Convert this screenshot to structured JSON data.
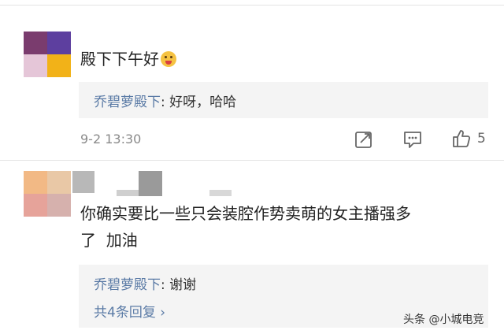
{
  "comments": [
    {
      "text": "殿下下午好",
      "emoji": "smiling-face-emoji",
      "reply": {
        "name": "乔碧萝殿下",
        "text": ": 好呀，哈哈"
      },
      "time": "9-2 13:30",
      "like_count": "5"
    },
    {
      "text_line1": "你确实要比一些只会装腔作势卖萌的女主播强多",
      "text_line2": "了  加油",
      "reply": {
        "name": "乔碧萝殿下",
        "text": ": 谢谢"
      },
      "more_replies": "共4条回复 ›"
    }
  ],
  "watermark": "头条 @小城电竞",
  "colors": {
    "avatar1": [
      "#7a3c6e",
      "#5d3f9f",
      "#e5c6d8",
      "#f2b218"
    ],
    "avatar2": [
      "#f2b985",
      "#e9c8a6",
      "#e6a39a",
      "#d6b1ad"
    ],
    "reply_name": "#5b7ba6",
    "reply_bg": "#f4f4f4"
  }
}
